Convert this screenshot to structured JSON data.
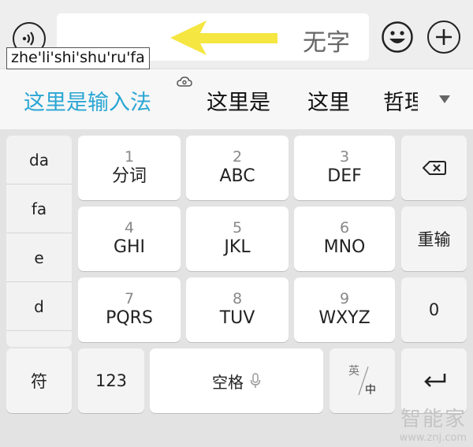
{
  "input_bar": {
    "placeholder_text": "无字",
    "composing_pinyin": "zhe'li'shi'shu'ru'fa",
    "arrow_color": "#f5e641"
  },
  "candidates": {
    "items": [
      "这里是输入法",
      "这里是",
      "这里",
      "哲理"
    ],
    "highlight_color": "#2aa6d4"
  },
  "keyboard": {
    "left_list": [
      "da",
      "fa",
      "e",
      "d"
    ],
    "keys": [
      {
        "num": "1",
        "label": "分词"
      },
      {
        "num": "2",
        "label": "ABC"
      },
      {
        "num": "3",
        "label": "DEF"
      },
      {
        "num": "4",
        "label": "GHI"
      },
      {
        "num": "5",
        "label": "JKL"
      },
      {
        "num": "6",
        "label": "MNO"
      },
      {
        "num": "7",
        "label": "PQRS"
      },
      {
        "num": "8",
        "label": "TUV"
      },
      {
        "num": "9",
        "label": "WXYZ"
      }
    ],
    "reinput_label": "重输",
    "zero_label": "0",
    "symbol_label": "符",
    "numbers_label": "123",
    "space_label": "空格",
    "lang_top": "英",
    "lang_bottom": "中"
  },
  "watermark": {
    "name": "智能家",
    "url": "www.znj.com"
  }
}
